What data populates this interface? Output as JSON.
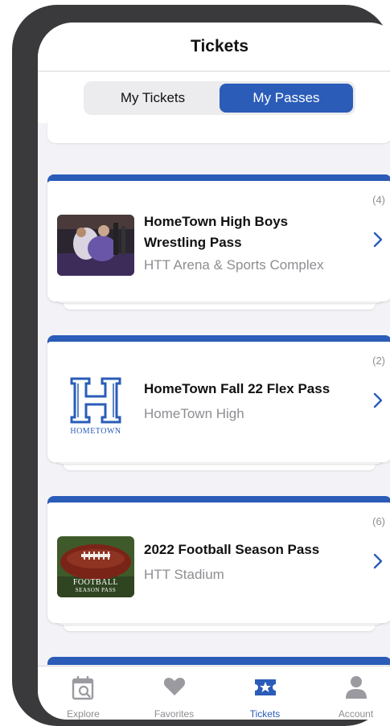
{
  "header": {
    "title": "Tickets"
  },
  "segment": {
    "tabs": [
      {
        "label": "My Tickets"
      },
      {
        "label": "My Passes"
      }
    ],
    "active": "My Passes"
  },
  "passes": [
    {
      "count": "(4)",
      "name": "HomeTown High Boys Wrestling Pass",
      "venue": "HTT Arena & Sports Complex",
      "thumb": "wrestling-photo"
    },
    {
      "count": "(2)",
      "name": "HomeTown Fall 22 Flex Pass",
      "venue": "HomeTown High",
      "thumb": "hometown-logo",
      "logo_text": "HOMETOWN"
    },
    {
      "count": "(6)",
      "name": "2022 Football Season Pass",
      "venue": "HTT Stadium",
      "thumb": "football-photo",
      "thumb_text_1": "FOOTBALL",
      "thumb_text_2": "SEASON PASS"
    }
  ],
  "tabbar": {
    "items": [
      {
        "label": "Explore",
        "icon": "calendar-search-icon"
      },
      {
        "label": "Favorites",
        "icon": "heart-icon"
      },
      {
        "label": "Tickets",
        "icon": "ticket-star-icon"
      },
      {
        "label": "Account",
        "icon": "person-icon"
      }
    ],
    "active": "Tickets"
  },
  "colors": {
    "accent": "#2a5cb8",
    "muted": "#8e8e93",
    "background": "#f2f2f7"
  }
}
